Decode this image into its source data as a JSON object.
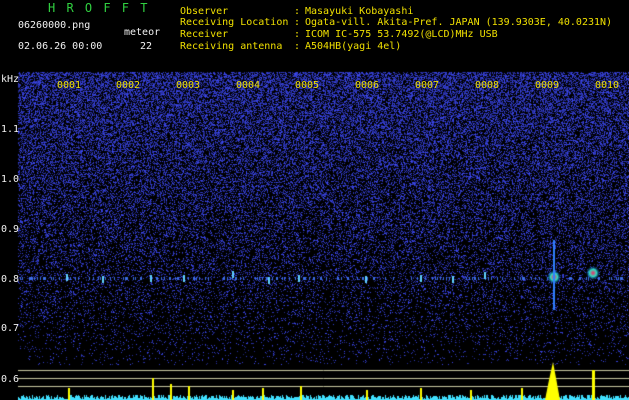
{
  "header": {
    "app_title": "H R O F F T",
    "filename": "06260000.png",
    "datetime": "02.06.26 00:00",
    "meteor_label": "meteor",
    "meteor_count": "22"
  },
  "info": [
    {
      "label": "Observer",
      "sep": ":",
      "value": "Masayuki Kobayashi"
    },
    {
      "label": "Receiving Location",
      "sep": ":",
      "value": "Ogata-vill. Akita-Pref. JAPAN (139.9303E, 40.0231N)"
    },
    {
      "label": "Receiver",
      "sep": ":",
      "value": "ICOM IC-575 53.7492(@LCD)MHz USB"
    },
    {
      "label": "Receiving antenna",
      "sep": ":",
      "value": "A504HB(yagi 4el)"
    }
  ],
  "axis": {
    "unit_label": "kHz",
    "y_ticks": [
      "1.1",
      "1.0",
      "0.9",
      "0.8",
      "0.7",
      "0.6"
    ],
    "time_markers": [
      "0001",
      "0002",
      "0003",
      "0004",
      "0005",
      "0006",
      "0007",
      "0008",
      "0009",
      "0010"
    ]
  },
  "colors": {
    "background": "#000000",
    "header_title": "#30d040",
    "header_text": "#f2f2f2",
    "info_text": "#f0e000",
    "noise": "#3040d0",
    "echo_hot": "#ff2060",
    "histogram": "#40e0ff",
    "histogram_peak": "#ffff00"
  }
}
